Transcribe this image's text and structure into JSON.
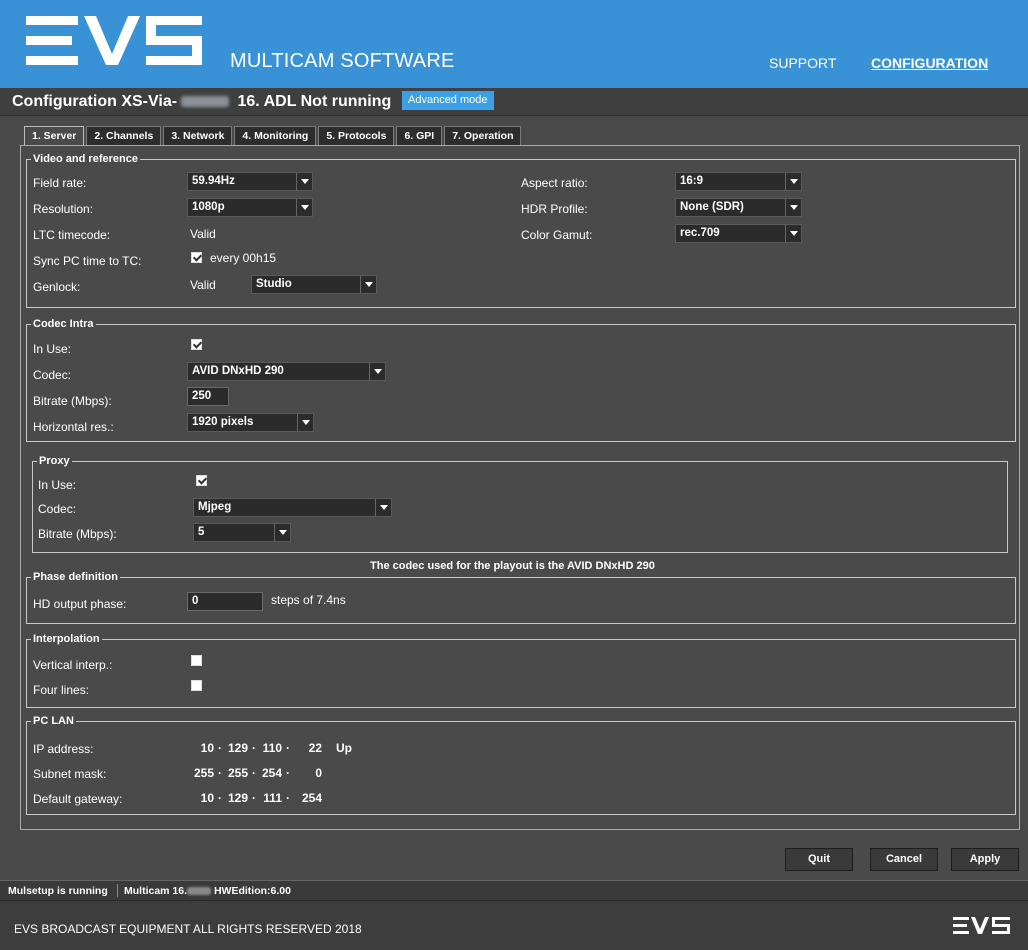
{
  "header": {
    "app_title": "MULTICAM SOFTWARE",
    "nav": {
      "support": "SUPPORT",
      "configuration": "CONFIGURATION"
    }
  },
  "titlebar": {
    "title_prefix": "Configuration XS-Via-",
    "title_suffix": " 16. ADL Not running",
    "badge": "Advanced mode"
  },
  "tabs": [
    "1. Server",
    "2. Channels",
    "3. Network",
    "4. Monitoring",
    "5. Protocols",
    "6. GPI",
    "7. Operation"
  ],
  "video": {
    "legend": "Video and reference",
    "field_rate_label": "Field rate:",
    "field_rate": "59.94Hz",
    "resolution_label": "Resolution:",
    "resolution": "1080p",
    "ltc_label": "LTC timecode:",
    "ltc": "Valid",
    "sync_label": "Sync PC time to TC:",
    "sync_checked": true,
    "sync_text": "every 00h15",
    "genlock_label": "Genlock:",
    "genlock_status": "Valid",
    "genlock_mode": "Studio",
    "aspect_label": "Aspect ratio:",
    "aspect": "16:9",
    "hdr_label": "HDR Profile:",
    "hdr": "None (SDR)",
    "gamut_label": "Color Gamut:",
    "gamut": "rec.709"
  },
  "codec_intra": {
    "legend": "Codec Intra",
    "in_use_label": "In Use:",
    "in_use": true,
    "codec_label": "Codec:",
    "codec": "AVID DNxHD 290",
    "bitrate_label": "Bitrate (Mbps):",
    "bitrate": "250",
    "hres_label": "Horizontal res.:",
    "hres": "1920 pixels"
  },
  "proxy": {
    "legend": "Proxy",
    "in_use_label": "In Use:",
    "in_use": true,
    "codec_label": "Codec:",
    "codec": "Mjpeg",
    "bitrate_label": "Bitrate (Mbps):",
    "bitrate": "5"
  },
  "codec_note": "The codec used for the playout is the AVID DNxHD 290",
  "phase": {
    "legend": "Phase definition",
    "label": "HD output phase:",
    "value": "0",
    "unit": "steps of 7.4ns"
  },
  "interp": {
    "legend": "Interpolation",
    "vertical_label": "Vertical interp.:",
    "vertical": false,
    "four_label": "Four lines:",
    "four": false
  },
  "pclan": {
    "legend": "PC LAN",
    "ip_label": "IP address:",
    "ip": [
      "10",
      "129",
      "110",
      "22"
    ],
    "ip_status": "Up",
    "mask_label": "Subnet mask:",
    "mask": [
      "255",
      "255",
      "254",
      "0"
    ],
    "gw_label": "Default gateway:",
    "gw": [
      "10",
      "129",
      "111",
      "254"
    ],
    "dot": "·"
  },
  "buttons": {
    "quit": "Quit",
    "cancel": "Cancel",
    "apply": "Apply"
  },
  "status": {
    "running": "Mulsetup is running",
    "version_prefix": "Multicam 16.",
    "hw_edition": " HWEdition:6.00"
  },
  "footer": {
    "copyright": "EVS BROADCAST EQUIPMENT ALL RIGHTS RESERVED 2018"
  }
}
